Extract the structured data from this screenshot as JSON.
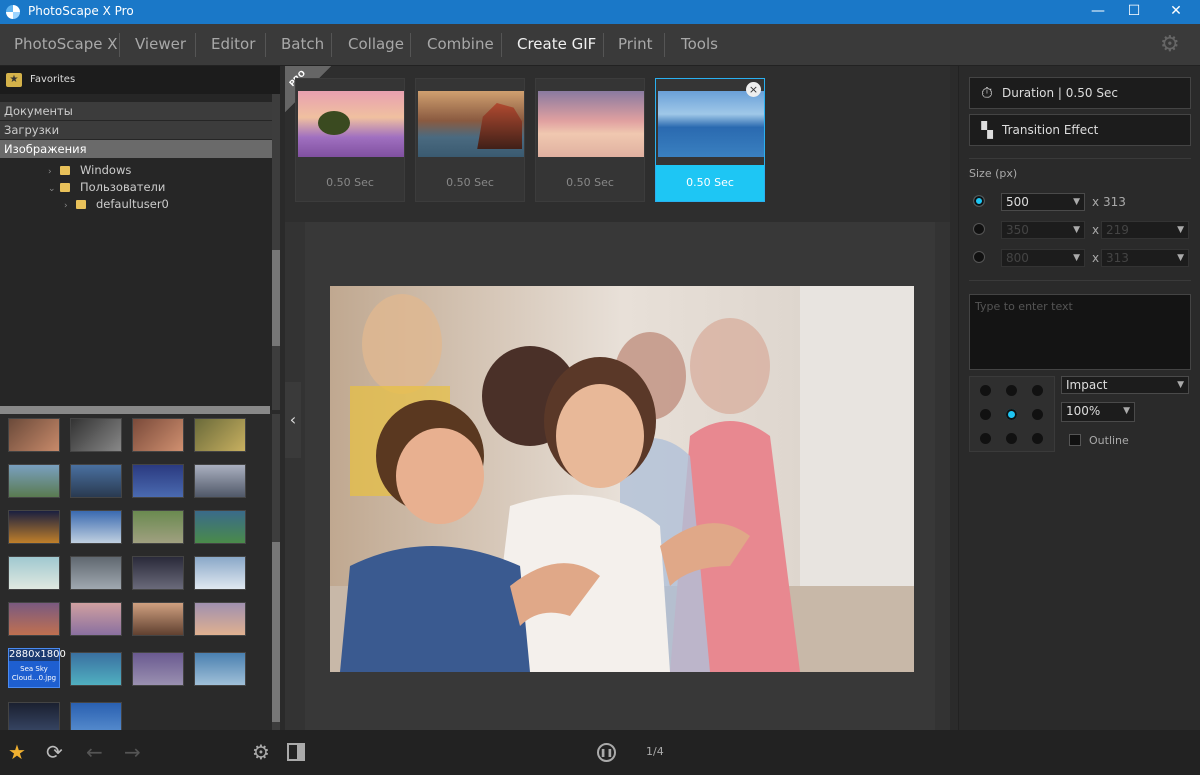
{
  "window": {
    "title": "PhotoScape X Pro",
    "minimize": "—",
    "maximize": "☐",
    "close": "✕"
  },
  "menu": {
    "items": [
      "PhotoScape X",
      "Viewer",
      "Editor",
      "Batch",
      "Collage",
      "Combine",
      "Create GIF",
      "Print",
      "Tools"
    ],
    "active": "Create GIF",
    "settings_icon": "gear-icon"
  },
  "left": {
    "favorites_label": "Favorites",
    "tree": {
      "docs": "Документы",
      "downloads": "Загрузки",
      "images": "Изображения",
      "windows": "Windows",
      "users": "Пользователи",
      "defaultuser": "defaultuser0"
    },
    "selected_thumb": {
      "size": "2880x1800",
      "name": "Sea Sky Cloud...0.jpg"
    }
  },
  "frames": [
    {
      "duration": "0.50 Sec"
    },
    {
      "duration": "0.50 Sec"
    },
    {
      "duration": "0.50 Sec"
    },
    {
      "duration": "0.50 Sec",
      "selected": true
    }
  ],
  "pro_badge": {
    "label": "PRO"
  },
  "right": {
    "duration_btn": "Duration | 0.50 Sec",
    "transition_btn": "Transition Effect",
    "size_label": "Size (px)",
    "size_rows": [
      {
        "width": "500",
        "x": "x",
        "height": "313",
        "selected": true
      },
      {
        "width": "350",
        "x": "x",
        "height": "219",
        "selected": false
      },
      {
        "width": "800",
        "x": "x",
        "height": "313",
        "selected": false
      }
    ],
    "text_placeholder": "Type to enter text",
    "font": "Impact",
    "scale": "100%",
    "outline_label": "Outline"
  },
  "bottom": {
    "page_indicator": "1/4"
  },
  "colors": {
    "accent": "#1ec6f4",
    "titlebar": "#1a78c8"
  }
}
